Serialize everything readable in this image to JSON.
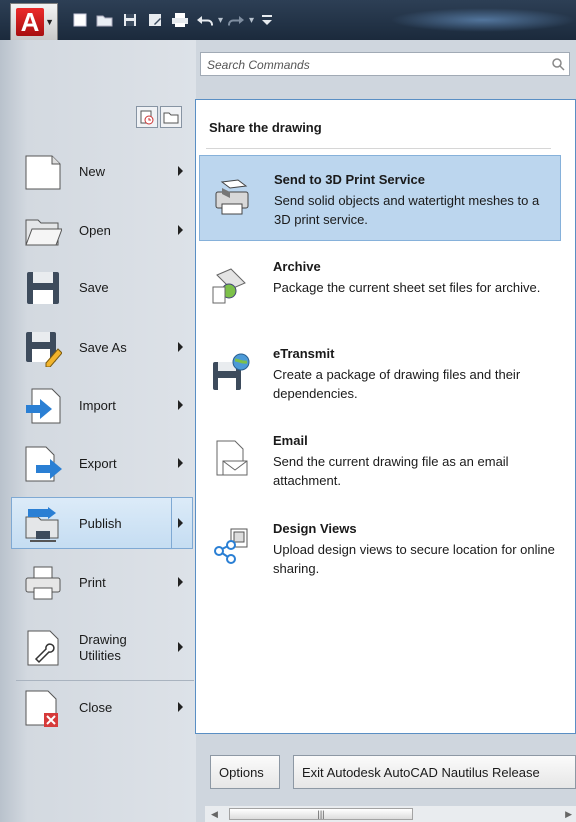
{
  "search": {
    "placeholder": "Search Commands"
  },
  "menu": {
    "items": [
      {
        "label": "New",
        "icon": "new-file-icon"
      },
      {
        "label": "Open",
        "icon": "folder-open-icon"
      },
      {
        "label": "Save",
        "icon": "save-icon"
      },
      {
        "label": "Save As",
        "icon": "save-as-icon"
      },
      {
        "label": "Import",
        "icon": "import-icon"
      },
      {
        "label": "Export",
        "icon": "export-icon"
      },
      {
        "label": "Publish",
        "icon": "publish-icon"
      },
      {
        "label": "Print",
        "icon": "printer-icon"
      },
      {
        "label": "Drawing\nUtilities",
        "icon": "drawing-utilities-icon"
      },
      {
        "label": "Close",
        "icon": "close-file-icon"
      }
    ]
  },
  "panel": {
    "title": "Share the drawing",
    "options": [
      {
        "title": "Send to 3D Print Service",
        "desc": "Send solid objects and watertight meshes to a 3D print service.",
        "icon": "3d-print-icon"
      },
      {
        "title": "Archive",
        "desc": "Package the current sheet set files for archive.",
        "icon": "archive-icon"
      },
      {
        "title": "eTransmit",
        "desc": "Create a package of drawing files and their dependencies.",
        "icon": "etransmit-icon"
      },
      {
        "title": "Email",
        "desc": "Send the current drawing file as an email attachment.",
        "icon": "email-icon"
      },
      {
        "title": "Design Views",
        "desc": "Upload design views to secure location for online sharing.",
        "icon": "design-views-icon"
      }
    ]
  },
  "buttons": {
    "options": "Options",
    "exit": "Exit Autodesk AutoCAD Nautilus Release"
  },
  "colors": {
    "accent": "#5a8fc4",
    "highlight": "#bcd6ee",
    "titlebar": "#1b2a3c"
  }
}
